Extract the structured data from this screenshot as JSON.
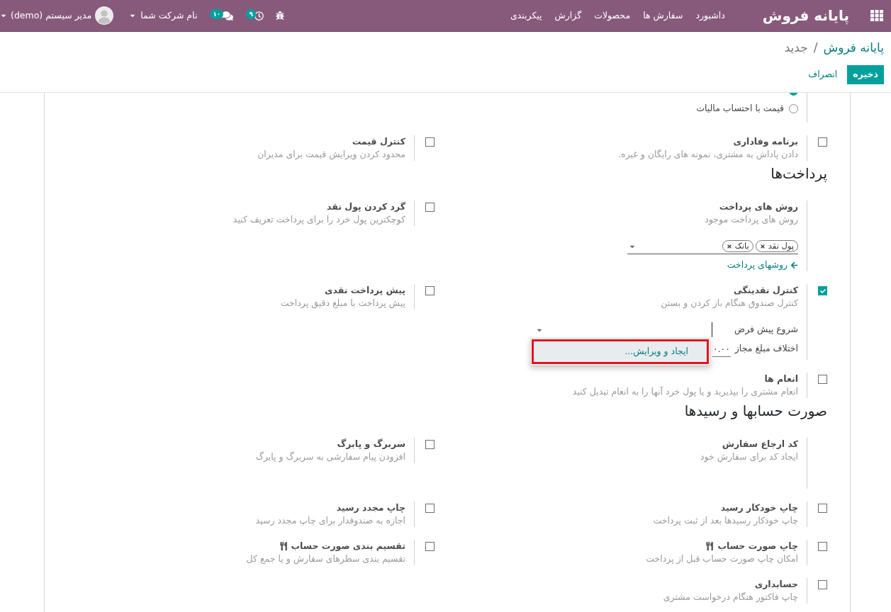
{
  "navbar": {
    "app_title": "پایانه فروش",
    "menu": [
      "داشبورد",
      "سفارش ها",
      "محصولات",
      "گزارش",
      "پیکربندی"
    ],
    "systray": {
      "activity_count": "۹",
      "message_count": "۱۰",
      "company": "نام شرکت شما",
      "user": "مدیر سیستم (demo)"
    }
  },
  "control_panel": {
    "breadcrumb": [
      "پایانه فروش",
      "جدید"
    ],
    "separator": "/",
    "buttons": [
      {
        "label": "ذخیره",
        "kind": "primary"
      },
      {
        "label": "انصراف",
        "kind": "link"
      }
    ]
  },
  "blocks": [
    {
      "kind": "row",
      "right": {
        "kind": "radio",
        "options": [
          {
            "selected": true
          },
          {
            "label": "قیمت با احتساب مالیات",
            "selected": false
          }
        ]
      }
    },
    {
      "kind": "row",
      "right": {
        "kind": "checkbox",
        "checked": false,
        "title": "برنامه وفاداری",
        "description": "دادن پاداش به مشتری، نمونه های رایگان و غیره."
      },
      "left": {
        "kind": "checkbox",
        "checked": false,
        "title": "کنترل قیمت",
        "description": "محدود کردن ویرایش قیمت برای مدیران"
      }
    },
    {
      "kind": "heading",
      "text": "پرداخت‌ها"
    },
    {
      "kind": "row",
      "right": {
        "kind": "plain",
        "title": "روش های پرداخت",
        "description": "روش های پرداخت موجود",
        "tags": [
          "پول نقد",
          "بانک"
        ],
        "link": "روشهای پرداخت"
      },
      "left": {
        "kind": "checkbox",
        "checked": false,
        "title": "گرد کردن پول نقد",
        "description": "کوچکترین پول خرد را برای پرداخت تعریف کنید"
      }
    },
    {
      "kind": "row",
      "right": {
        "kind": "checkbox",
        "checked": true,
        "title": "کنترل نقدینگی",
        "description": "کنترل صندوق هنگام باز کردن و بستن",
        "fields": [
          {
            "kind": "select",
            "label": "شروع پیش فرض",
            "focused": true,
            "options": [
              {
                "label": "ایجاد و ویرایش...",
                "selected": true,
                "annotated": true
              }
            ]
          },
          {
            "kind": "number",
            "label": "اختلاف مبلغ مجاز",
            "value": "۰.۰۰"
          }
        ]
      },
      "left": {
        "kind": "checkbox",
        "checked": false,
        "title": "پیش پرداخت نقدی",
        "description": "پیش پرداخت با مبلغ دقیق پرداخت"
      }
    },
    {
      "kind": "row",
      "right": {
        "kind": "checkbox",
        "checked": false,
        "title": "انعام ها",
        "description": "انعام مشتری را بپذیرید و یا پول خرد آنها را به انعام تبدیل کنید"
      }
    },
    {
      "kind": "heading",
      "text": "صورت حسابها و رسیدها"
    },
    {
      "kind": "row",
      "right": {
        "kind": "plain",
        "title": "کد ارجاع سفارش",
        "description": "ایجاد کد برای سفارش خود"
      },
      "left": {
        "kind": "checkbox",
        "checked": false,
        "title": "سربرگ و پابرگ",
        "description": "افزودن پیام سفارشی به سربرگ و پابرگ"
      }
    },
    {
      "kind": "row",
      "right": {
        "kind": "checkbox",
        "checked": false,
        "title": "چاپ خودکار رسید",
        "description": "چاپ خودکار رسیدها بعد از ثبت پرداخت"
      },
      "left": {
        "kind": "checkbox",
        "checked": false,
        "title": "چاپ مجدد رسید",
        "description": "اجازه به صندوقدار برای چاپ مجدد رسید"
      }
    },
    {
      "kind": "row",
      "right": {
        "kind": "checkbox",
        "checked": false,
        "title": "چاپ صورت حساب",
        "restaurant": true,
        "description": "امکان چاپ صورت حساب قبل از پرداخت"
      },
      "left": {
        "kind": "checkbox",
        "checked": false,
        "title": "تقسیم بندی صورت حساب",
        "restaurant": true,
        "description": "تقسیم بندی سطرهای سفارش و یا جمع کل"
      }
    },
    {
      "kind": "row",
      "right": {
        "kind": "checkbox",
        "checked": false,
        "title": "حسابداری",
        "description": "چاپ فاکتور هنگام درخواست مشتری"
      }
    }
  ]
}
